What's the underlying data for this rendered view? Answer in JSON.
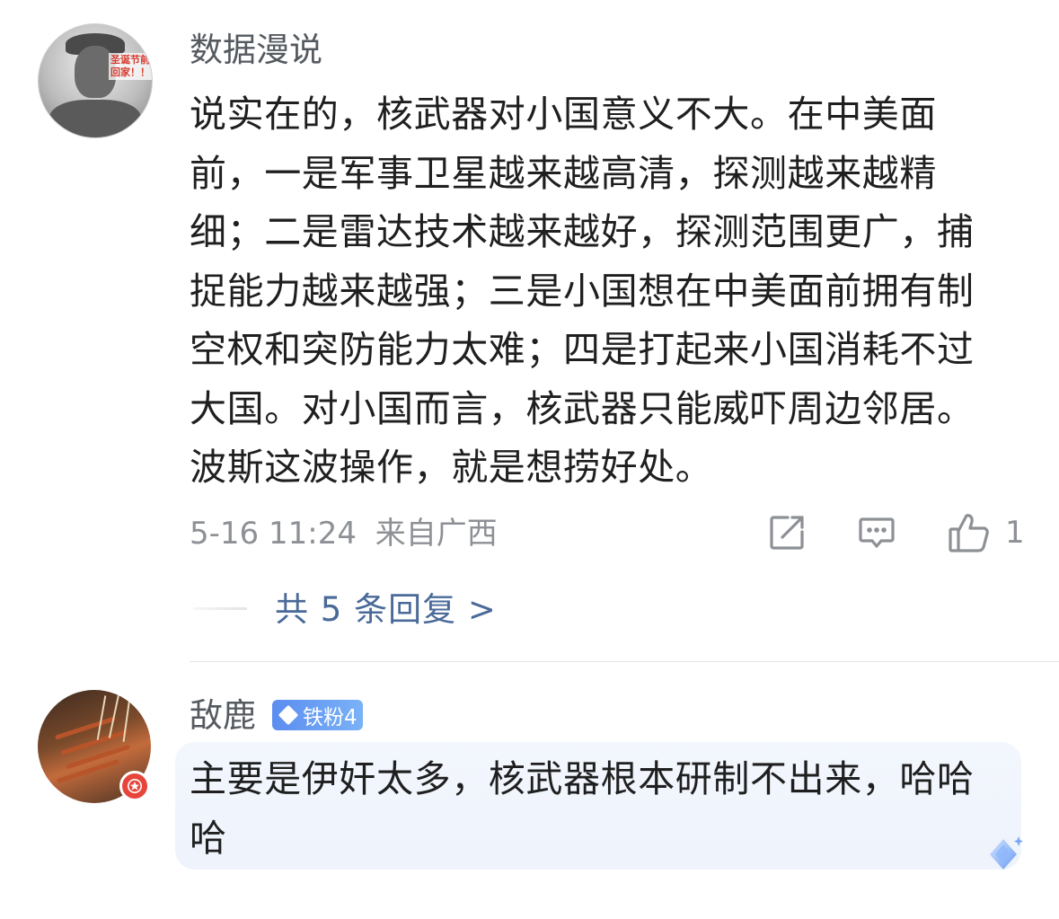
{
  "comments": [
    {
      "username": "数据漫说",
      "avatar_caption": "圣诞节前\n回家！！",
      "text": "说实在的，核武器对小国意义不大。在中美面前，一是军事卫星越来越高清，探测越来越精细；二是雷达技术越来越好，探测范围更广，捕捉能力越来越强；三是小国想在中美面前拥有制空权和突防能力太难；四是打起来小国消耗不过大国。对小国而言，核武器只能威吓周边邻居。波斯这波操作，就是想捞好处。",
      "timestamp": "5-16 11:24",
      "location": "来自广西",
      "like_count": "1",
      "replies_link": "共 5 条回复 >"
    },
    {
      "username": "敌鹿",
      "fan_badge": "铁粉4",
      "text": "主要是伊奸太多，核武器根本研制不出来，哈哈哈"
    }
  ],
  "icons": {
    "share": "share-icon",
    "reply": "comment-icon",
    "like": "thumbs-up-icon",
    "star_badge": "star-icon",
    "fan_diamond": "diamond-icon",
    "decoration": "sparkle-diamond-icon"
  },
  "colors": {
    "link": "#4a6a99",
    "meta": "#8d9095",
    "fan_badge": "#5b8df0",
    "star_badge": "#e7453a",
    "highlight_bg": "#f0f4fc"
  }
}
